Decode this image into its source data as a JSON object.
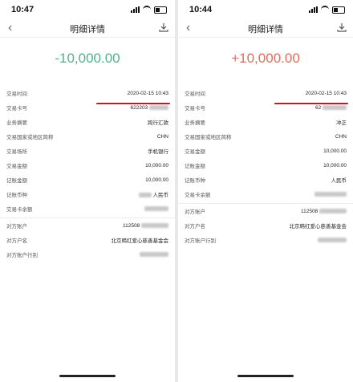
{
  "left": {
    "status_time": "10:47",
    "title": "明细详情",
    "amount": "-10,000.00",
    "rows": [
      {
        "k": "交易时间",
        "v": "2020-02-15 10:43"
      },
      {
        "k": "交易卡号",
        "v": "622203"
      },
      {
        "k": "业务摘要",
        "v": "跨行汇款"
      },
      {
        "k": "交易国家或地区简称",
        "v": "CHN"
      },
      {
        "k": "交易场所",
        "v": "手机银行"
      },
      {
        "k": "交易金额",
        "v": "10,000.00"
      },
      {
        "k": "记账金额",
        "v": "10,000.00"
      },
      {
        "k": "记账币种",
        "v": "人民币"
      },
      {
        "k": "交易卡余额",
        "v": ""
      },
      {
        "k": "对方账户",
        "v": "112508"
      },
      {
        "k": "对方户名",
        "v": "北京韩红爱心慈善基金会"
      },
      {
        "k": "对方账户行别",
        "v": ""
      }
    ]
  },
  "right": {
    "status_time": "10:44",
    "title": "明细详情",
    "amount": "+10,000.00",
    "rows": [
      {
        "k": "交易时间",
        "v": "2020-02-15 10:43"
      },
      {
        "k": "交易卡号",
        "v": "62"
      },
      {
        "k": "业务摘要",
        "v": "冲正"
      },
      {
        "k": "交易国家或地区简称",
        "v": "CHN"
      },
      {
        "k": "交易金额",
        "v": "10,000.00"
      },
      {
        "k": "记账金额",
        "v": "10,000.00"
      },
      {
        "k": "记账币种",
        "v": "人民币"
      },
      {
        "k": "交易卡余额",
        "v": ""
      },
      {
        "k": "对方账户",
        "v": "112508"
      },
      {
        "k": "对方户名",
        "v": "北京韩红爱心慈善基金会"
      },
      {
        "k": "对方账户行别",
        "v": ""
      }
    ]
  },
  "colors": {
    "negative": "#4fb38c",
    "positive": "#e56b5b",
    "highlight": "#d1121b"
  },
  "icons": {
    "back": "chevron-left-icon",
    "download": "download-icon"
  }
}
